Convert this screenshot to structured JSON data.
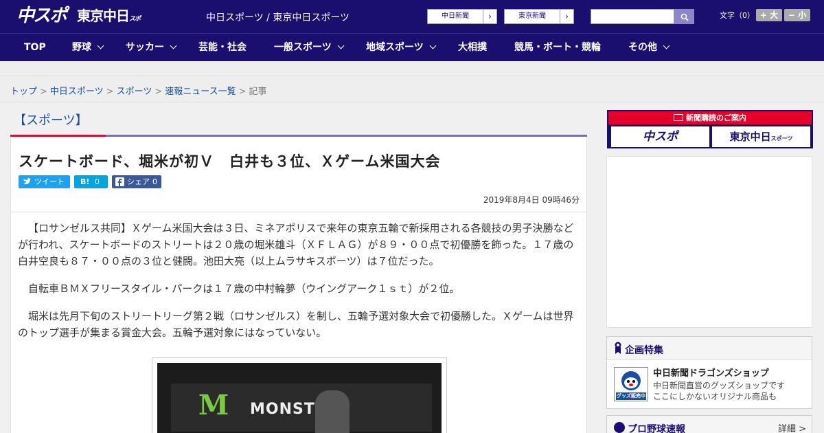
{
  "header": {
    "logo_chu": "中スポ",
    "logo_tokyo": "東京中日",
    "logo_tokyo_small": "スポーツ",
    "site_name": "中日スポーツ / 東京中日スポーツ",
    "paper_links": [
      {
        "label": "中日新聞",
        "arrow": "›"
      },
      {
        "label": "東京新聞",
        "arrow": "›"
      }
    ],
    "search": {
      "placeholder": ""
    },
    "font_size_label": "文字（0）",
    "font_larger": "+ 大",
    "font_smaller": "− 小"
  },
  "nav": {
    "items": [
      {
        "label": "TOP",
        "dropdown": false
      },
      {
        "label": "野球",
        "dropdown": true
      },
      {
        "label": "サッカー",
        "dropdown": true
      },
      {
        "label": "芸能・社会",
        "dropdown": false
      },
      {
        "label": "一般スポーツ",
        "dropdown": true
      },
      {
        "label": "地域スポーツ",
        "dropdown": true
      },
      {
        "label": "大相撲",
        "dropdown": false
      },
      {
        "label": "競馬・ボート・競輪",
        "dropdown": false
      },
      {
        "label": "その他",
        "dropdown": true
      }
    ]
  },
  "breadcrumb": {
    "items": [
      "トップ",
      "中日スポーツ",
      "スポーツ",
      "速報ニュース一覧"
    ],
    "current": "記事",
    "separator": ">"
  },
  "article": {
    "category": "【スポーツ】",
    "headline": "スケートボード、堀米が初Ｖ　白井も３位、Ｘゲーム米国大会",
    "share": {
      "tweet_label": "ツイート",
      "hatena_label": "B!",
      "hatena_count": "0",
      "facebook_label": "シェア",
      "facebook_count": "0"
    },
    "date": "2019年8月4日 09時46分",
    "paragraphs": [
      "【ロサンゼルス共同】Ｘゲーム米国大会は３日、ミネアポリスで来年の東京五輪で新採用される各競技の男子決勝などが行われ、スケートボードのストリートは２０歳の堀米雄斗（ＸＦＬＡＧ）が８９・００点で初優勝を飾った。１７歳の白井空良も８７・００点の３位と健闘。池田大亮（以上ムラサキスポーツ）は７位だった。",
      "自転車ＢＭＸフリースタイル・パークは１７歳の中村輪夢（ウイングアーク１ｓｔ）が２位。",
      "堀米は先月下旬のストリートリーグ第２戦（ロサンゼルス）を制し、五輪予選対象大会で初優勝した。Ｘゲームは世界のトップ選手が集まる賞金大会。五輪予選対象にはなっていない。"
    ],
    "photo_text": "MONSTER"
  },
  "sidebar": {
    "subscription_title": "新聞購読のご案内",
    "sub_logo_chu": "中スポ",
    "sub_logo_tokyo": "東京中日",
    "sub_logo_tokyo_small": "スポーツ",
    "feature_title": "企画特集",
    "shop_name": "中日新聞ドラゴンズショップ",
    "shop_desc_1": "中日新聞直営のグッズショップです",
    "shop_desc_2": "ここにしかないオリジナル商品も",
    "shop_thumb_text": "グッズ販売中",
    "baseball_title": "プロ野球速報",
    "baseball_more": "詳細 >"
  },
  "colors": {
    "brand_navy": "#1a0e6e",
    "accent_red": "#d2152c",
    "link_blue": "#1a4ea0",
    "twitter": "#1da1f2",
    "hatena": "#00a4de",
    "facebook": "#3b5998"
  }
}
